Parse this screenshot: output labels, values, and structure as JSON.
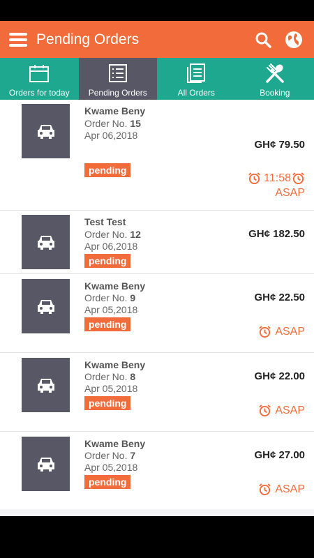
{
  "appbar": {
    "title": "Pending Orders",
    "menu_icon": "hamburger-menu-icon",
    "search_icon": "search-icon",
    "globe_icon": "globe-icon"
  },
  "tabs": [
    {
      "label": "Orders for today",
      "icon": "calendar-icon",
      "active": false
    },
    {
      "label": "Pending Orders",
      "icon": "list-icon",
      "active": true
    },
    {
      "label": "All Orders",
      "icon": "document-list-icon",
      "active": false
    },
    {
      "label": "Booking",
      "icon": "fork-spoon-icon",
      "active": false
    }
  ],
  "orders": [
    {
      "name": "Kwame Beny",
      "order_prefix": "Order No. ",
      "order_no": "15",
      "date": "Apr 06,2018",
      "status": "pending",
      "price": "GH¢ 79.50",
      "time": "11:58",
      "asap": "ASAP"
    },
    {
      "name": "Test Test",
      "order_prefix": "Order No. ",
      "order_no": "12",
      "date": "Apr 06,2018",
      "status": "pending",
      "price": "GH¢ 182.50"
    },
    {
      "name": "Kwame Beny",
      "order_prefix": "Order No. ",
      "order_no": "9",
      "date": "Apr 05,2018",
      "status": "pending",
      "price": "GH¢ 22.50",
      "asap": "ASAP"
    },
    {
      "name": "Kwame Beny",
      "order_prefix": "Order No. ",
      "order_no": "8",
      "date": "Apr 05,2018",
      "status": "pending",
      "price": "GH¢ 22.00",
      "asap": "ASAP"
    },
    {
      "name": "Kwame Beny",
      "order_prefix": "Order No. ",
      "order_no": "7",
      "date": "Apr 05,2018",
      "status": "pending",
      "price": "GH¢ 27.00",
      "asap": "ASAP"
    }
  ],
  "colors": {
    "accent": "#f26b3a",
    "teal": "#1fa890",
    "slate": "#575766"
  }
}
